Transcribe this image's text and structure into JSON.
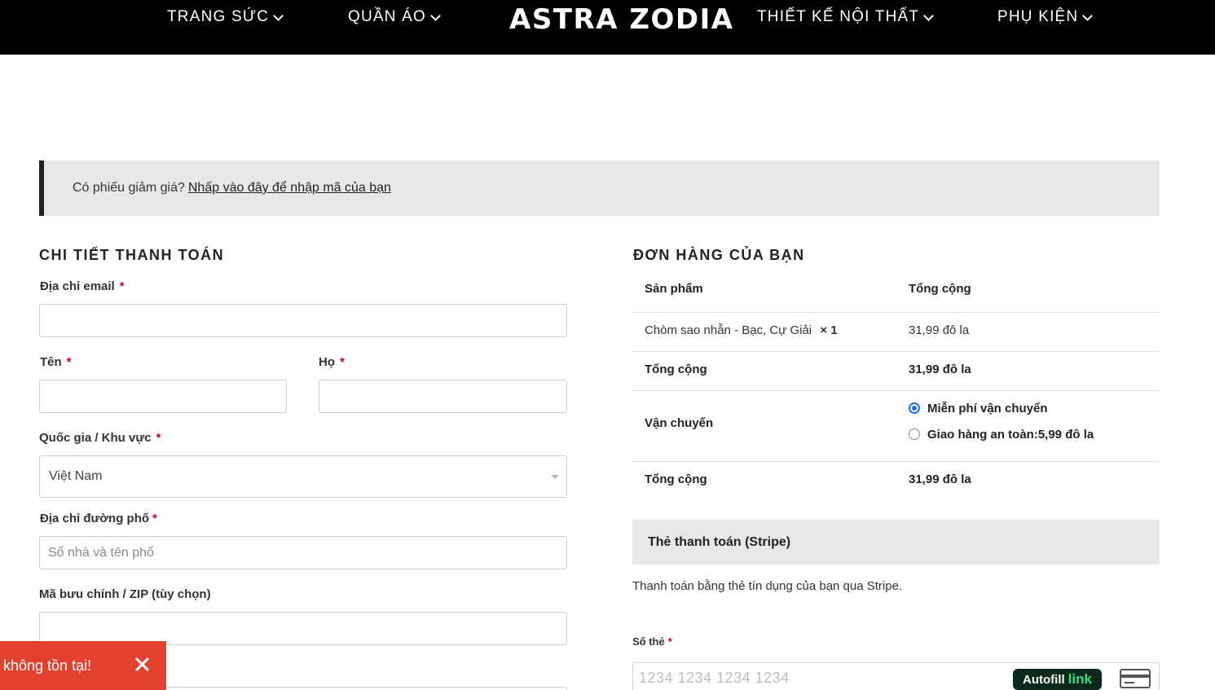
{
  "header": {
    "nav": [
      {
        "label": "TRANG SỨC"
      },
      {
        "label": "QUẦN ÁO"
      },
      {
        "label": "THIẾT KẾ NỘI THẤT"
      },
      {
        "label": "PHỤ KIỆN"
      }
    ],
    "logo": "ASTRA ZODIA"
  },
  "coupon": {
    "text": "Có phiếu giảm giá?",
    "link": "Nhấp vào đây để nhập mã của bạn"
  },
  "billing": {
    "title": "CHI TIẾT THANH TOÁN",
    "email_label": "Địa chỉ email",
    "first_name_label": "Tên",
    "last_name_label": "Họ",
    "country_label": "Quốc gia / Khu vực",
    "country_value": "Việt Nam",
    "street_label": "Địa chỉ đường phố",
    "street_placeholder": "Số nhà và tên phố",
    "zip_label": "Mã bưu chính / ZIP (tùy chọn)",
    "required_mark": "*"
  },
  "order": {
    "title": "ĐƠN HÀNG CỦA BẠN",
    "col_product": "Sản phẩm",
    "col_total": "Tổng cộng",
    "item_name": "Chòm sao nhẫn - Bạc, Cự Giải",
    "item_qty": "× 1",
    "item_price": "31,99 đô la",
    "subtotal_label": "Tổng cộng",
    "subtotal_value": "31,99 đô la",
    "shipping_label": "Vận chuyển",
    "shipping_options": [
      {
        "label": "Miễn phí vận chuyển",
        "selected": true
      },
      {
        "label": "Giao hàng an toàn:5,99 đô la",
        "selected": false
      }
    ],
    "total_label": "Tổng cộng",
    "total_value": "31,99 đô la"
  },
  "payment": {
    "method": "Thẻ thanh toán (Stripe)",
    "description": "Thanh toán bằng thẻ tín dụng của bạn qua Stripe.",
    "card_label": "Số thẻ",
    "card_placeholder": "1234 1234 1234 1234",
    "autofill_text": "Autofill",
    "autofill_link": "link"
  },
  "toast": {
    "message": "không tồn tại!"
  },
  "colors": {
    "header_bg": "#000000",
    "required": "#d0021b",
    "toast_bg": "#e3412d",
    "radio_selected": "#1f6feb",
    "autofill_bg": "#0b2a1c",
    "autofill_link": "#33dd7a"
  }
}
